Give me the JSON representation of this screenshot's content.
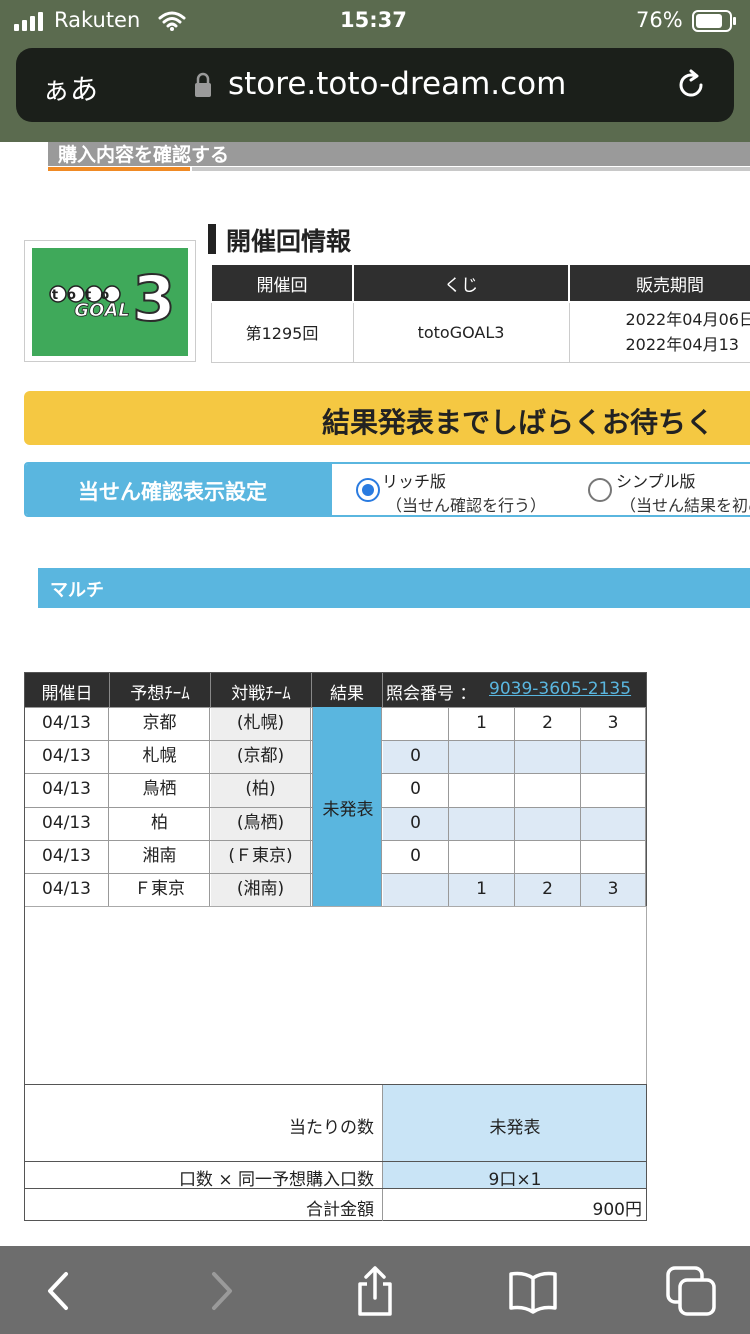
{
  "status_bar": {
    "carrier": "Rakuten",
    "time": "15:37",
    "battery": "76%"
  },
  "browser": {
    "text_size_label": "ぁあ",
    "url": "store.toto-dream.com"
  },
  "page": {
    "step_label": "購入内容を確認する",
    "logo": {
      "word_top": "toto",
      "word_bottom": "GOAL",
      "digit": "3"
    },
    "kaisai_info": {
      "title": "開催回情報",
      "headers": [
        "開催回",
        "くじ",
        "販売期間"
      ],
      "kaisai": "第1295回",
      "kuji": "totoGOAL3",
      "period_line1": "2022年04月06日",
      "period_line2": "2022年04月13"
    },
    "banner_text": "結果発表までしばらくお待ちく",
    "display_setting": {
      "label": "当せん確認表示設定",
      "option1_title": "リッチ版",
      "option1_sub": "（当せん確認を行う）",
      "option2_title": "シンプル版",
      "option2_sub": "（当せん結果を初め"
    },
    "section_label": "マルチ",
    "result_table": {
      "headers": [
        "開催日",
        "予想ﾁｰﾑ",
        "対戦ﾁｰﾑ",
        "結果"
      ],
      "inquiry_label": "照会番号 ：",
      "inquiry_number": "9039-3605-2135",
      "result_status": "未発表",
      "rows": [
        {
          "date": "04/13",
          "team": "京都",
          "opponent": "(札幌)",
          "c0": "",
          "c1": "1",
          "c2": "2",
          "c3": "3"
        },
        {
          "date": "04/13",
          "team": "札幌",
          "opponent": "(京都)",
          "c0": "0",
          "c1": "",
          "c2": "",
          "c3": ""
        },
        {
          "date": "04/13",
          "team": "鳥栖",
          "opponent": "(柏)",
          "c0": "0",
          "c1": "",
          "c2": "",
          "c3": ""
        },
        {
          "date": "04/13",
          "team": "柏",
          "opponent": "(鳥栖)",
          "c0": "0",
          "c1": "",
          "c2": "",
          "c3": ""
        },
        {
          "date": "04/13",
          "team": "湘南",
          "opponent": "(Ｆ東京)",
          "c0": "0",
          "c1": "",
          "c2": "",
          "c3": ""
        },
        {
          "date": "04/13",
          "team": "Ｆ東京",
          "opponent": "(湘南)",
          "c0": "",
          "c1": "1",
          "c2": "2",
          "c3": "3"
        }
      ]
    },
    "summary": {
      "hits_label": "当たりの数",
      "hits_value": "未発表",
      "units_label": "口数 × 同一予想購入口数",
      "units_value": "9口×1",
      "total_label": "合計金額",
      "total_value": "900円"
    }
  },
  "colors": {
    "chrome_bg": "#5b6b4f",
    "banner_yellow": "#f5c842",
    "accent_blue": "#5ab6df",
    "cell_blue": "#c9e4f6",
    "stripe_blue": "#dde9f5",
    "header_dark": "#2f2f2f",
    "logo_green": "#3fa95a",
    "link_blue": "#1f6fc4"
  }
}
